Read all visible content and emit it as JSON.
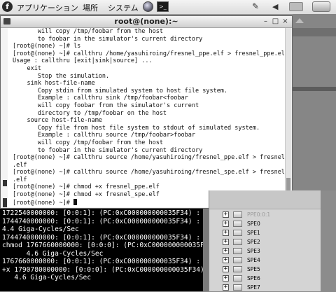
{
  "top_panel": {
    "menus": [
      "アプリケーション",
      "場所",
      "システム"
    ]
  },
  "terminal": {
    "title": "root@(none):~",
    "lines": [
      "       will copy /tmp/foobar from the host",
      "       to foobar in the simulator's current directory",
      "[root@(none) ~]# ls",
      "[root@(none) ~]# callthru /home/yasuhiroing/fresnel_ppe.elf > fresnel_ppe.elf",
      "Usage : callthru [exit|sink|source] ...",
      "    exit",
      "       Stop the simulation.",
      "    sink host-file-name",
      "       Copy stdin from simulated system to host file system.",
      "       Example : callthru sink /tmp/foobar<foobar",
      "       will copy foobar from the simulator's current",
      "       directory to /tmp/foobar on the host",
      "    source host-file-name",
      "       Copy file from host file system to stdout of simulated system.",
      "       Example : callthru source /tmp/foobar>foobar",
      "       will copy /tmp/foobar from the host",
      "       to foobar in the simulator's current directory",
      "[root@(none) ~]# callthru source /home/yasuhiroing/fresnel_ppe.elf > fresnel_ppe",
      ".elf",
      "[root@(none) ~]# callthru source /home/yasuhiroing/fresnel_spe.elf > fresnel_spe",
      ".elf",
      "[root@(none) ~]# chmod +x fresnel_ppe.elf",
      "[root@(none) ~]# chmod +x fresnel_spe.elf",
      "[root@(none) ~]# "
    ]
  },
  "sim_console": {
    "lines": [
      "1722540000000: [0:0:1]: (PC:0xC000000000035F34) :",
      "1744740000000: [0:0:1]: (PC:0xC000000000035F34) :",
      "4.4 Giga-Cycles/Sec",
      "1744740000000: [0:0:1]: (PC:0xC000000000035F34) :",
      "chmod 1767660000000: [0:0:0]: (PC:0xC000000000035F",
      "      4.6 Giga-Cycles/Sec",
      "1767660000000: [0:0:1]: (PC:0xC000000000035F34) :",
      "+x 1790780000000: [0:0:0]: (PC:0xC000000000035F34)",
      "   4.6 Giga-Cycles/Sec"
    ]
  },
  "spe_tree": {
    "items": [
      {
        "label": "PPE0:0:1",
        "dim": true
      },
      {
        "label": "SPE0",
        "dim": false
      },
      {
        "label": "SPE1",
        "dim": false
      },
      {
        "label": "SPE2",
        "dim": false
      },
      {
        "label": "SPE3",
        "dim": false
      },
      {
        "label": "SPE4",
        "dim": false
      },
      {
        "label": "SPE5",
        "dim": false
      },
      {
        "label": "SPE6",
        "dim": false
      },
      {
        "label": "SPE7",
        "dim": false
      }
    ]
  }
}
